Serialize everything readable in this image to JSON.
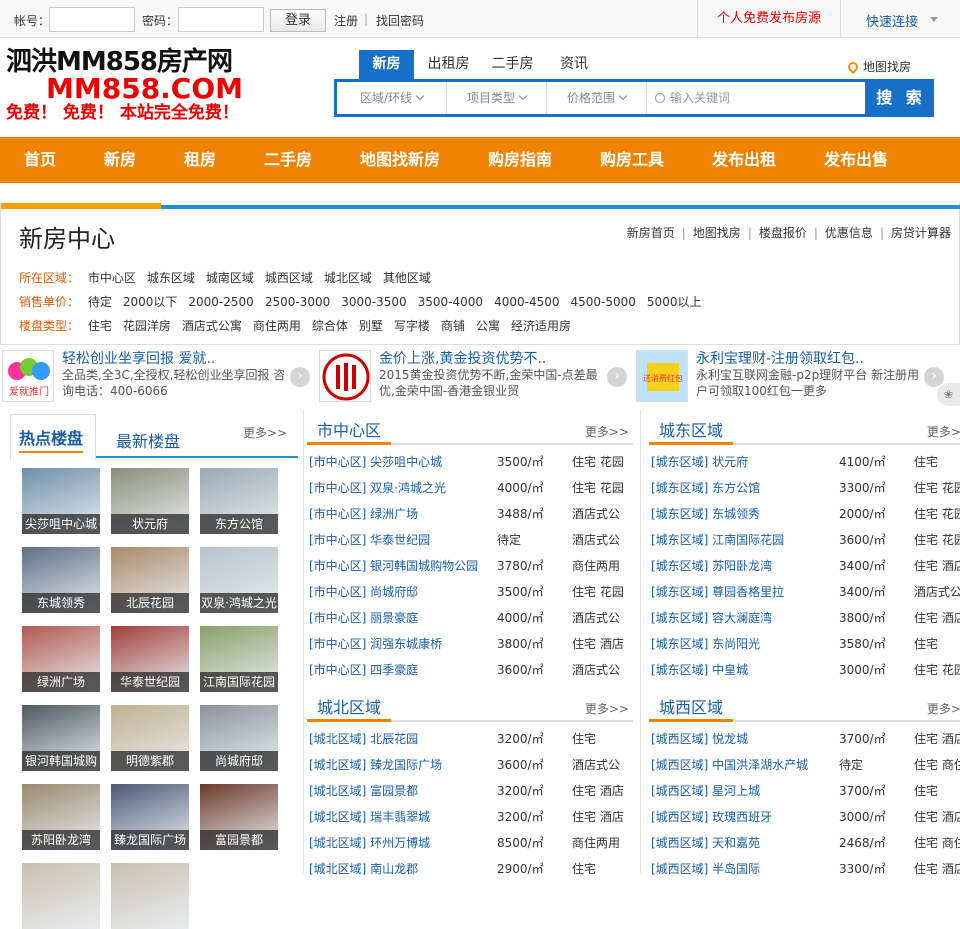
{
  "topbar": {
    "account_label": "帐号：",
    "password_label": "密码：",
    "login": "登录",
    "register": "注册",
    "recover": "找回密码",
    "free_post": "个人免费发布房源",
    "quick_link": "快速连接"
  },
  "logo": {
    "line1": "泗洪MM858房产网",
    "line2": "MM858.COM",
    "line3": "免费！ 免费！ 本站完全免费！"
  },
  "search": {
    "tabs": [
      "新房",
      "出租房",
      "二手房",
      "资讯"
    ],
    "area": "区域/环线",
    "type": "项目类型",
    "price": "价格范围",
    "placeholder": "输入关键词",
    "button": "搜 索",
    "map_find": "地图找房"
  },
  "nav": [
    "首页",
    "新房",
    "租房",
    "二手房",
    "地图找新房",
    "购房指南",
    "购房工具",
    "发布出租",
    "发布出售"
  ],
  "house_center": {
    "title": "新房中心",
    "links": [
      "新房首页",
      "地图找房",
      "楼盘报价",
      "优惠信息",
      "房贷计算器"
    ],
    "filters": [
      {
        "key": "所在区域：",
        "values": [
          "市中心区",
          "城东区域",
          "城南区域",
          "城西区域",
          "城北区域",
          "其他区域"
        ]
      },
      {
        "key": "销售单价：",
        "values": [
          "待定",
          "2000以下",
          "2000-2500",
          "2500-3000",
          "3000-3500",
          "3500-4000",
          "4000-4500",
          "4500-5000",
          "5000以上"
        ]
      },
      {
        "key": "楼盘类型：",
        "values": [
          "住宅",
          "花园洋房",
          "酒店式公寓",
          "商住两用",
          "综合体",
          "别墅",
          "写字楼",
          "商铺",
          "公寓",
          "经济适用房"
        ]
      }
    ]
  },
  "ads": [
    {
      "title": "轻松创业坐享回报 爱就..",
      "desc": "全品类,全3C,全授权,轻松创业坐享回报 咨询电话：400-6066",
      "logo": "爱就推门"
    },
    {
      "title": "金价上涨,黄金投资优势不..",
      "desc": "2015黄金投资优势不断,金荣中国-点差最优,金荣中国-香港金银业贸"
    },
    {
      "title": "永利宝理财-注册领取红包..",
      "desc": "永利宝互联网金融-p2p理财平台 新注册用户可领取100红包一更多",
      "logo": "送消费红包"
    }
  ],
  "left": {
    "tab_hot": "热点楼盘",
    "tab_new": "最新楼盘",
    "more": "更多>>",
    "thumbs": [
      "尖莎咀中心城",
      "状元府",
      "东方公馆",
      "东城领秀",
      "北辰花园",
      "双泉·鸿城之光",
      "绿洲广场",
      "华泰世纪园",
      "江南国际花园",
      "银河韩国城购",
      "明德紫郡",
      "尚城府邸",
      "苏阳卧龙湾",
      "臻龙国际广场",
      "富园景都",
      "",
      ""
    ]
  },
  "panels": [
    {
      "title": "市中心区",
      "more": "更多>>",
      "rows": [
        [
          "[市中心区] 尖莎咀中心城",
          "3500/㎡",
          "住宅 花园"
        ],
        [
          "[市中心区] 双泉·鸿城之光",
          "4000/㎡",
          "住宅 花园"
        ],
        [
          "[市中心区] 绿洲广场",
          "3488/㎡",
          "酒店式公"
        ],
        [
          "[市中心区] 华泰世纪园",
          "待定",
          "酒店式公"
        ],
        [
          "[市中心区] 银河韩国城购物公园",
          "3780/㎡",
          "商住两用"
        ],
        [
          "[市中心区] 尚城府邸",
          "3500/㎡",
          "住宅 花园"
        ],
        [
          "[市中心区] 丽景豪庭",
          "4000/㎡",
          "酒店式公"
        ],
        [
          "[市中心区] 润强东城康桥",
          "3800/㎡",
          "住宅 酒店"
        ],
        [
          "[市中心区] 四季豪庭",
          "3600/㎡",
          "酒店式公"
        ]
      ]
    },
    {
      "title": "城东区域",
      "more": "更多>>",
      "rows": [
        [
          "[城东区域] 状元府",
          "4100/㎡",
          "住宅"
        ],
        [
          "[城东区域] 东方公馆",
          "3300/㎡",
          "住宅 花园"
        ],
        [
          "[城东区域] 东城领秀",
          "2000/㎡",
          "住宅 花园"
        ],
        [
          "[城东区域] 江南国际花园",
          "3600/㎡",
          "住宅 花园"
        ],
        [
          "[城东区域] 苏阳卧龙湾",
          "3400/㎡",
          "住宅 酒店"
        ],
        [
          "[城东区域] 尊园香格里拉",
          "3400/㎡",
          "酒店式公"
        ],
        [
          "[城东区域] 容大澜庭湾",
          "3800/㎡",
          "住宅 酒店"
        ],
        [
          "[城东区域] 东尚阳光",
          "3580/㎡",
          "住宅"
        ],
        [
          "[城东区域] 中皇城",
          "3000/㎡",
          "住宅 花园"
        ]
      ]
    },
    {
      "title": "城北区域",
      "more": "更多>>",
      "rows": [
        [
          "[城北区域] 北辰花园",
          "3200/㎡",
          "住宅"
        ],
        [
          "[城北区域] 臻龙国际广场",
          "3600/㎡",
          "酒店式公"
        ],
        [
          "[城北区域] 富园景都",
          "3200/㎡",
          "住宅 酒店"
        ],
        [
          "[城北区域] 瑞丰翡翠城",
          "3200/㎡",
          "住宅 酒店"
        ],
        [
          "[城北区域] 环州万博城",
          "8500/㎡",
          "商住两用"
        ],
        [
          "[城北区域] 南山龙郡",
          "2900/㎡",
          "住宅"
        ]
      ]
    },
    {
      "title": "城西区域",
      "more": "更多>>",
      "rows": [
        [
          "[城西区域] 悦龙城",
          "3700/㎡",
          "住宅 酒店"
        ],
        [
          "[城西区域] 中国洪泽湖水产城",
          "待定",
          "住宅 商住"
        ],
        [
          "[城西区域] 星河上城",
          "3700/㎡",
          "住宅"
        ],
        [
          "[城西区域] 玫瑰西班牙",
          "3000/㎡",
          "住宅 酒店"
        ],
        [
          "[城西区域] 天和嘉苑",
          "2468/㎡",
          "住宅 商住"
        ],
        [
          "[城西区域] 半岛国际",
          "3300/㎡",
          "住宅 酒店"
        ]
      ]
    }
  ]
}
